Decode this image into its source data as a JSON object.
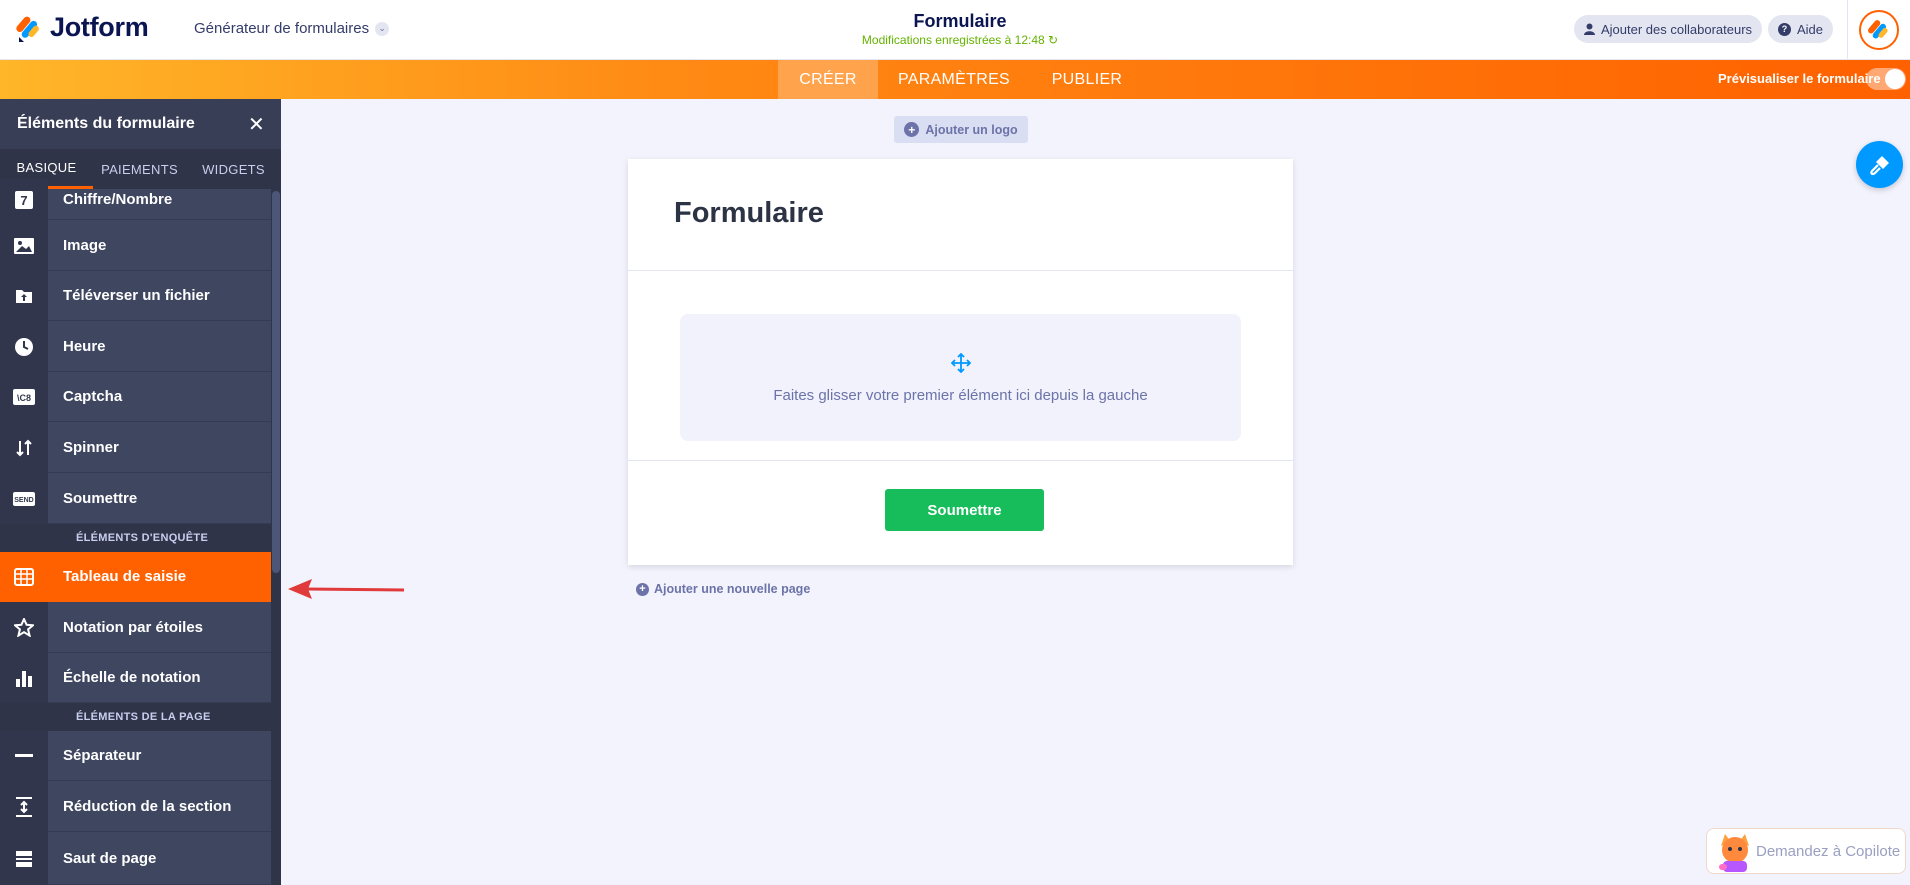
{
  "header": {
    "logo": "Jotform",
    "builder_menu": "Générateur de formulaires",
    "form_title": "Formulaire",
    "saved_status": "Modifications enregistrées à 12:48",
    "collaborators": "Ajouter des collaborateurs",
    "help": "Aide"
  },
  "main_tabs": [
    "CRÉER",
    "PARAMÈTRES",
    "PUBLIER"
  ],
  "preview_label": "Prévisualiser le formulaire",
  "preview_on": false,
  "sidebar": {
    "title": "Éléments du formulaire",
    "tabs": [
      "BASIQUE",
      "PAIEMENTS",
      "WIDGETS"
    ],
    "items": [
      {
        "label": "Chiffre/Nombre",
        "icon": "number-icon"
      },
      {
        "label": "Image",
        "icon": "image-icon"
      },
      {
        "label": "Téléverser un fichier",
        "icon": "file-upload-icon"
      },
      {
        "label": "Heure",
        "icon": "clock-icon"
      },
      {
        "label": "Captcha",
        "icon": "captcha-icon"
      },
      {
        "label": "Spinner",
        "icon": "spinner-icon"
      },
      {
        "label": "Soumettre",
        "icon": "send-icon"
      }
    ],
    "section_survey": "ÉLÉMENTS D'ENQUÊTE",
    "survey_items": [
      {
        "label": "Tableau de saisie",
        "icon": "table-icon"
      },
      {
        "label": "Notation par étoiles",
        "icon": "star-icon"
      },
      {
        "label": "Échelle de notation",
        "icon": "bar-chart-icon"
      }
    ],
    "section_page": "ÉLÉMENTS DE LA PAGE",
    "page_items": [
      {
        "label": "Séparateur",
        "icon": "divider-icon"
      },
      {
        "label": "Réduction de la section",
        "icon": "collapse-icon"
      },
      {
        "label": "Saut de page",
        "icon": "page-break-icon"
      }
    ]
  },
  "canvas": {
    "add_logo": "Ajouter un logo",
    "form_heading": "Formulaire",
    "drop_hint": "Faites glisser votre premier élément ici depuis la gauche",
    "submit": "Soumettre",
    "add_page": "Ajouter une nouvelle page"
  },
  "copilot": "Demandez à Copilote",
  "colors": {
    "accent": "#ff6100",
    "sidebar": "#3f4660",
    "submit": "#18bd5b",
    "annotation_arrow": "#e03a3a"
  }
}
